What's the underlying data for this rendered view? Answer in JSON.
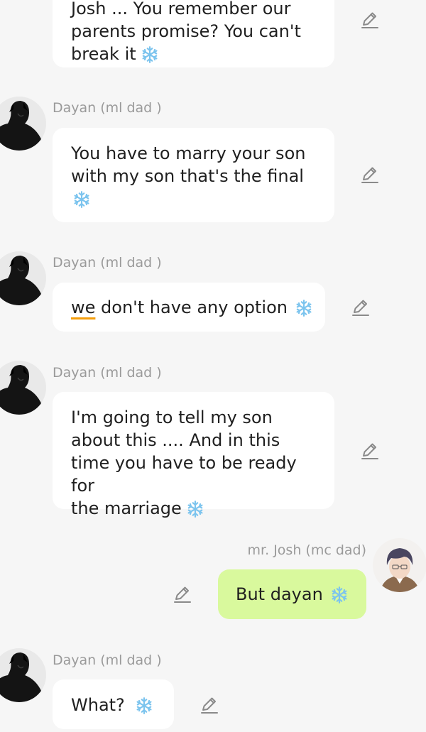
{
  "messages": [
    {
      "sender": "",
      "lines": [
        "Josh ... You remember our",
        "parents promise?  You can't",
        "break it"
      ],
      "has_snowflake": true
    },
    {
      "sender": "Dayan (ml dad )",
      "lines": [
        "You have to marry your son",
        "with my son that's the final"
      ],
      "has_snowflake": true
    },
    {
      "sender": "Dayan (ml dad )",
      "lines": [
        "we",
        " don't have any option"
      ],
      "has_snowflake": true
    },
    {
      "sender": "Dayan (ml dad )",
      "lines": [
        "I'm going to tell my son",
        "about this .... And in this",
        "time you have to be ready for",
        "the marriage"
      ],
      "has_snowflake": true
    },
    {
      "sender": "mr. Josh (mc dad)",
      "lines": [
        "But dayan"
      ],
      "has_snowflake": true
    },
    {
      "sender": "Dayan (ml dad )",
      "lines": [
        "What?"
      ],
      "has_snowflake": true
    }
  ],
  "icons": {
    "edit": "pencil-edit-icon",
    "snowflake": "snowflake-icon"
  },
  "colors": {
    "background": "#f6f6f6",
    "incoming_bubble": "#ffffff",
    "outgoing_bubble": "#d9f99d",
    "sender_name": "#9a9a9a",
    "snowflake": "#7cc4ee",
    "underline": "#f59e0b"
  }
}
